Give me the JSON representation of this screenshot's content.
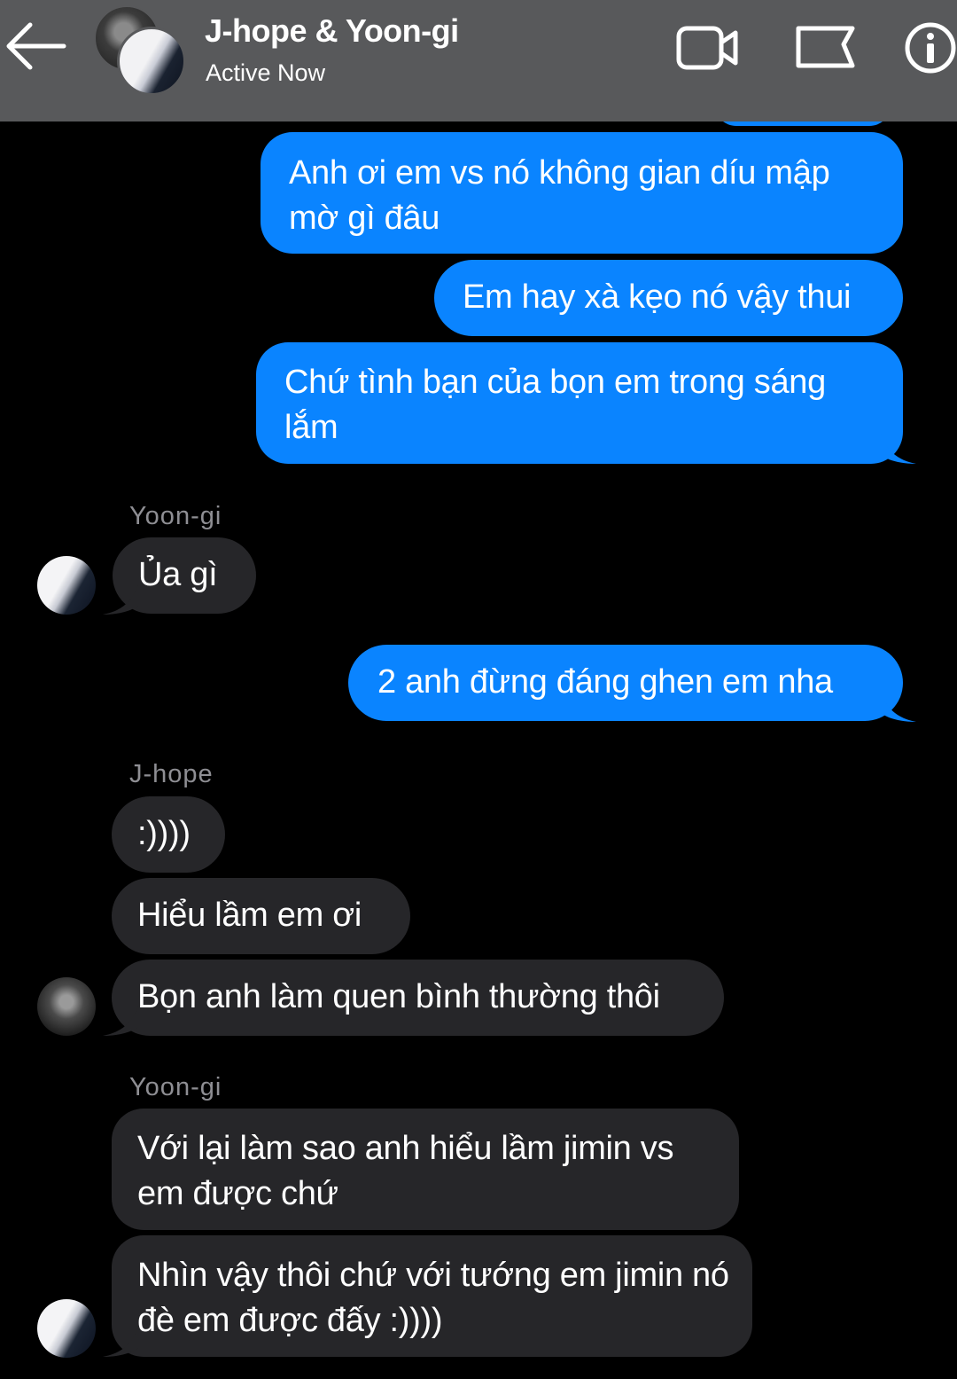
{
  "header": {
    "title": "J-hope & Yoon-gi",
    "status": "Active Now",
    "icons": [
      "back-arrow-icon",
      "video-call-icon",
      "flag-icon",
      "info-icon"
    ]
  },
  "colors": {
    "header_bg": "#58595b",
    "outgoing_bubble": "#0a84ff",
    "incoming_bubble": "#262629",
    "sender_label": "#8e8e93",
    "background": "#000000"
  },
  "messages": [
    {
      "direction": "out",
      "text": "Anh ơi em vs nó không gian díu mập mờ gì đâu"
    },
    {
      "direction": "out",
      "text": "Em hay xà kẹo nó vậy thui"
    },
    {
      "direction": "out",
      "text": "Chứ tình bạn của bọn em trong sáng lắm"
    },
    {
      "direction": "in",
      "sender": "Yoon-gi",
      "text": "Ủa gì"
    },
    {
      "direction": "out",
      "text": "2 anh đừng đáng ghen em nha"
    },
    {
      "direction": "in",
      "sender": "J-hope",
      "text": ":))))"
    },
    {
      "direction": "in",
      "text": "Hiểu lầm em ơi"
    },
    {
      "direction": "in",
      "text": "Bọn anh làm quen bình thường thôi"
    },
    {
      "direction": "in",
      "sender": "Yoon-gi",
      "text": "Với lại làm sao anh hiểu lầm jimin vs em được chứ"
    },
    {
      "direction": "in",
      "text": "Nhìn vậy thôi chứ với tướng em jimin nó đè em được đấy :))))"
    }
  ]
}
